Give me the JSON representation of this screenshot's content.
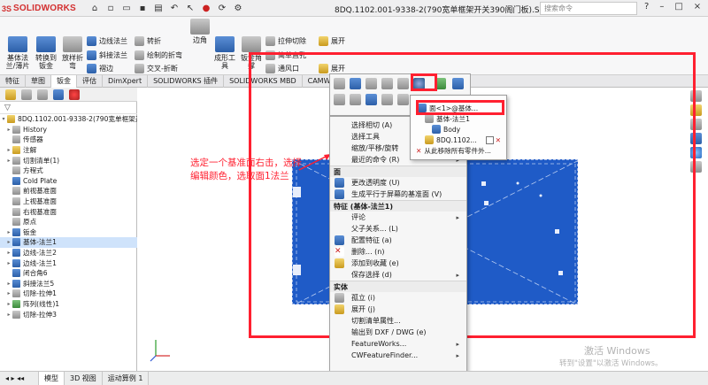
{
  "app": {
    "brand": "SOLIDWORKS",
    "brand_prefix": "3S"
  },
  "title_bar": {
    "document_title": "8DQ.1102.001-9338-2(790宽单框架开关390阁门板).SLDPRT",
    "search_placeholder": "搜索命令",
    "controls": [
      "?",
      "–",
      "□",
      "×"
    ]
  },
  "ribbon": {
    "big_buttons": [
      {
        "label": "基体法\n兰/薄片"
      },
      {
        "label": "转换到\n钣金"
      },
      {
        "label": "放样折\n弯"
      },
      {
        "label": "边角"
      },
      {
        "label": "成形工\n具"
      },
      {
        "label": "钣金角\n撑"
      }
    ],
    "small_buttons": [
      {
        "label": "边线法兰"
      },
      {
        "label": "斜接法兰"
      },
      {
        "label": "褶边"
      },
      {
        "label": "转折"
      },
      {
        "label": "绘制的折弯"
      },
      {
        "label": "交叉-折断"
      },
      {
        "label": "拉伸切除"
      },
      {
        "label": "简单直孔"
      },
      {
        "label": "通风口"
      },
      {
        "label": "展开"
      },
      {
        "label": "展开"
      }
    ]
  },
  "command_tabs": [
    "特征",
    "草图",
    "钣金",
    "评估",
    "DimXpert",
    "SOLIDWORKS 插件",
    "SOLIDWORKS MBD",
    "CAMWorks 2018-"
  ],
  "command_tabs_active": 2,
  "feature_tree": {
    "root": "8DQ.1102.001-9338-2(790宽单框架开",
    "items": [
      {
        "label": "History",
        "icon": "history-icon"
      },
      {
        "label": "传感器",
        "icon": "sensor-icon"
      },
      {
        "label": "注解",
        "icon": "annotation-icon"
      },
      {
        "label": "切割清单(1)",
        "icon": "cutlist-icon"
      },
      {
        "label": "方程式",
        "icon": "equation-icon"
      },
      {
        "label": "Cold Plate",
        "icon": "material-icon"
      },
      {
        "label": "前视基准面",
        "icon": "plane-icon"
      },
      {
        "label": "上视基准面",
        "icon": "plane-icon"
      },
      {
        "label": "右视基准面",
        "icon": "plane-icon"
      },
      {
        "label": "原点",
        "icon": "origin-icon"
      },
      {
        "label": "钣金",
        "icon": "sheetmetal-icon"
      },
      {
        "label": "基体-法兰1",
        "icon": "base-flange-icon",
        "selected": true
      },
      {
        "label": "边线-法兰2",
        "icon": "edge-flange-icon"
      },
      {
        "label": "边线-法兰1",
        "icon": "edge-flange-icon"
      },
      {
        "label": "闭合角6",
        "icon": "closed-corner-icon"
      },
      {
        "label": "斜接法兰5",
        "icon": "miter-flange-icon"
      },
      {
        "label": "切除-拉伸1",
        "icon": "cut-extrude-icon"
      },
      {
        "label": "阵列(线性)1",
        "icon": "linear-pattern-icon"
      },
      {
        "label": "切除-拉伸3",
        "icon": "cut-extrude-icon"
      }
    ]
  },
  "annotation_text": "选定一个基准面右击，选择编辑颜色，选取面1法兰",
  "appearance_menu": {
    "items": [
      {
        "label": "面<1>@基体...",
        "highlighted": true
      },
      {
        "label": "基体-法兰1"
      },
      {
        "label": "Body"
      },
      {
        "label": "8DQ.1102..."
      },
      {
        "label": "从此移除所有零件外..."
      }
    ]
  },
  "context_menu": {
    "items_top": [
      {
        "label": "选择相切 (A)"
      },
      {
        "label": "选择工具",
        "submenu": true
      },
      {
        "label": "缩放/平移/旋转",
        "submenu": true
      },
      {
        "label": "最近的命令 (R)",
        "submenu": true
      }
    ],
    "section_face": "面",
    "face_items": [
      {
        "label": "更改透明度 (U)"
      },
      {
        "label": "生成平行于屏幕的基准面 (V)"
      }
    ],
    "section_feature": "特征 (基体-法兰1)",
    "feature_items": [
      {
        "label": "评论",
        "submenu": true
      },
      {
        "label": "父子关系... (L)"
      },
      {
        "label": "配置特征 (a)"
      },
      {
        "label": "删除... (n)"
      },
      {
        "label": "添加到收藏 (e)"
      },
      {
        "label": "保存选择 (d)",
        "submenu": true
      }
    ],
    "section_body": "实体",
    "body_items": [
      {
        "label": "孤立 (i)"
      },
      {
        "label": "展开 (j)"
      },
      {
        "label": "切割清单属性..."
      },
      {
        "label": "输出到 DXF / DWG (e)"
      },
      {
        "label": "FeatureWorks...",
        "submenu": true
      },
      {
        "label": "CWFeatureFinder...",
        "submenu": true
      }
    ]
  },
  "bottom_tabs": [
    "模型",
    "3D 视图",
    "运动算例 1"
  ],
  "windows_watermark": {
    "line1": "激活 Windows",
    "line2": "转到\"设置\"以激活 Windows。"
  },
  "colors": {
    "accent_red": "#ff2030",
    "part_blue": "#1f5bc7",
    "selection_blue": "#cfe3fb"
  }
}
